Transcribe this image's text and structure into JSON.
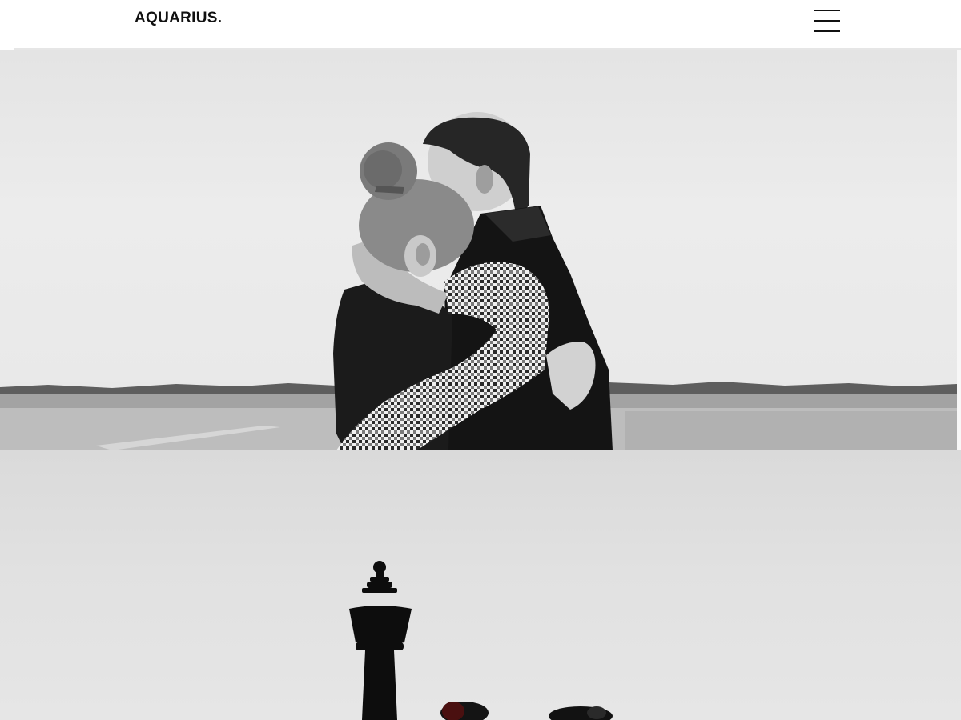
{
  "header": {
    "logo_text": "AQUARIUS.",
    "menu_icon": "hamburger-menu-icon"
  },
  "hero_image": {
    "description_icon": "couple-embrace-photo",
    "tone": "black-and-white"
  },
  "second_image": {
    "description_icon": "chess-pieces-photo",
    "tone": "black-and-white"
  },
  "colors": {
    "background": "#ffffff",
    "text": "#111111",
    "photo_sky": "#e8e8e8"
  }
}
